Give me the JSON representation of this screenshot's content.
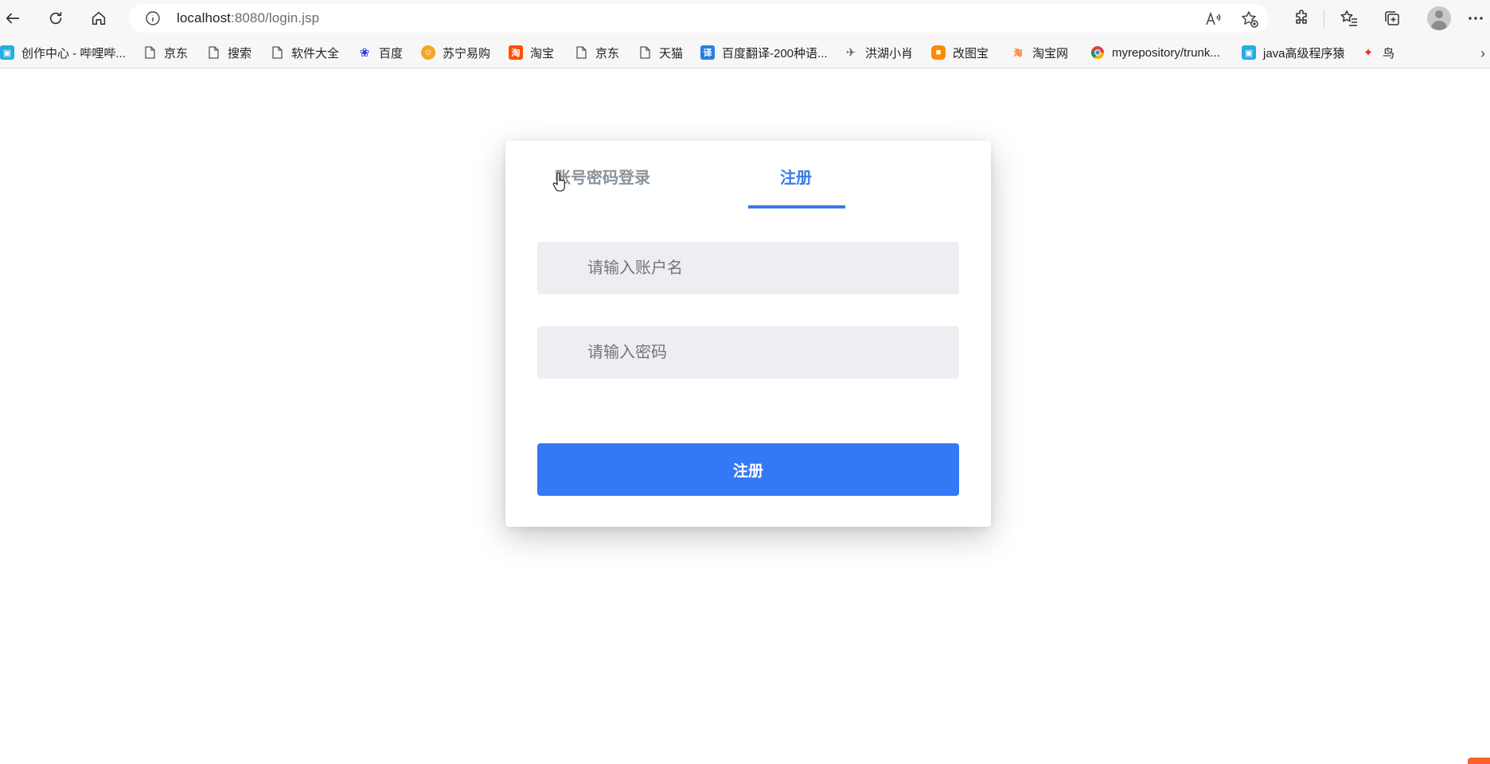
{
  "browser": {
    "url_host": "localhost",
    "url_rest": ":8080/login.jsp"
  },
  "bookmarks": [
    {
      "label": "创作中心 - 哔哩哔...",
      "icon": "bilibili-icon",
      "color": "#23ade5"
    },
    {
      "label": "京东",
      "icon": "page-icon",
      "color": "#555555"
    },
    {
      "label": "搜索",
      "icon": "page-icon",
      "color": "#555555"
    },
    {
      "label": "软件大全",
      "icon": "page-icon",
      "color": "#555555"
    },
    {
      "label": "百度",
      "icon": "baidu-icon",
      "color": "#2932e1"
    },
    {
      "label": "苏宁易购",
      "icon": "suning-icon",
      "color": "#f5a623"
    },
    {
      "label": "淘宝",
      "icon": "taobao-icon",
      "color": "#ff5000"
    },
    {
      "label": "京东",
      "icon": "page-icon",
      "color": "#555555"
    },
    {
      "label": "天猫",
      "icon": "page-icon",
      "color": "#555555"
    },
    {
      "label": "百度翻译-200种语...",
      "icon": "translate-icon",
      "color": "#2a7de1"
    },
    {
      "label": "洪湖小肖",
      "icon": "bird-icon",
      "color": "#666666"
    },
    {
      "label": "改图宝",
      "icon": "gaitubao-icon",
      "color": "#ff8a00"
    },
    {
      "label": "淘宝网",
      "icon": "taobao-icon",
      "color": "#ff7a1a"
    },
    {
      "label": "myrepository/trunk...",
      "icon": "chrome-icon",
      "color": "#db4437"
    },
    {
      "label": "java高级程序猿",
      "icon": "bilibili-icon",
      "color": "#23ade5"
    },
    {
      "label": "鸟",
      "icon": "bird-red-icon",
      "color": "#e0312a"
    }
  ],
  "form": {
    "tab_login": "账号密码登录",
    "tab_register": "注册",
    "username_placeholder": "请输入账户名",
    "password_placeholder": "请输入密码",
    "submit_label": "注册"
  },
  "colors": {
    "accent": "#3478f6",
    "tab_active": "#3a7bea",
    "tab_inactive": "#8a9399",
    "field_bg": "#eceef1"
  }
}
